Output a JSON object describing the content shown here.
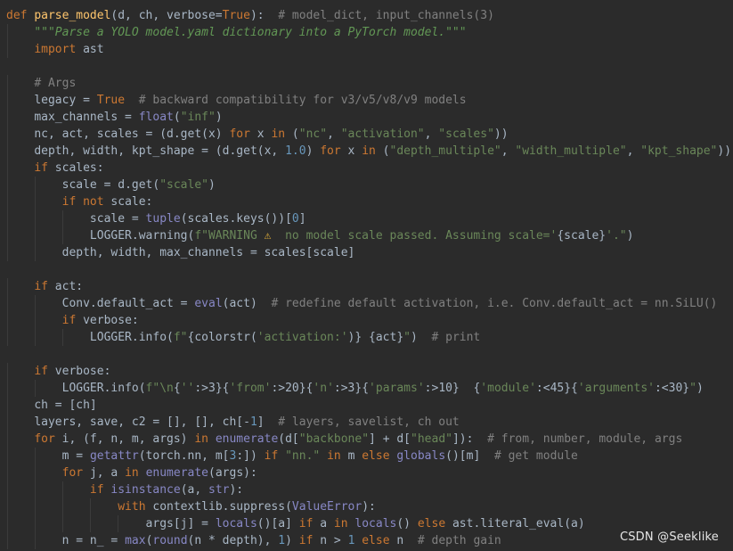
{
  "editor": {
    "theme": "dark",
    "colors": {
      "background": "#2b2b2b",
      "keyword": "#cc7832",
      "function": "#ffc66d",
      "builtin": "#8888c6",
      "string": "#6a8759",
      "docstring": "#629755",
      "comment": "#808080",
      "number": "#6897bb",
      "text": "#a9b7c6"
    },
    "lines": [
      {
        "indent": 0,
        "tokens": [
          [
            "kw",
            "def "
          ],
          [
            "fn",
            "parse_model"
          ],
          [
            "txt",
            "(d, ch, verbose="
          ],
          [
            "kw",
            "True"
          ],
          [
            "txt",
            "):  "
          ],
          [
            "cmt",
            "# model_dict, input_channels(3)"
          ]
        ]
      },
      {
        "indent": 1,
        "tokens": [
          [
            "doc",
            "\"\"\"Parse a YOLO model.yaml dictionary into a PyTorch model.\"\"\""
          ]
        ]
      },
      {
        "indent": 1,
        "tokens": [
          [
            "kw",
            "import "
          ],
          [
            "txt",
            "ast"
          ]
        ]
      },
      {
        "indent": 0,
        "tokens": []
      },
      {
        "indent": 1,
        "tokens": [
          [
            "cmt",
            "# Args"
          ]
        ]
      },
      {
        "indent": 1,
        "tokens": [
          [
            "txt",
            "legacy = "
          ],
          [
            "kw",
            "True  "
          ],
          [
            "cmt",
            "# backward compatibility for v3/v5/v8/v9 models"
          ]
        ]
      },
      {
        "indent": 1,
        "tokens": [
          [
            "txt",
            "max_channels = "
          ],
          [
            "bi",
            "float"
          ],
          [
            "txt",
            "("
          ],
          [
            "str",
            "\"inf\""
          ],
          [
            "txt",
            ")"
          ]
        ]
      },
      {
        "indent": 1,
        "tokens": [
          [
            "txt",
            "nc, act, scales = (d.get(x) "
          ],
          [
            "kw",
            "for "
          ],
          [
            "txt",
            "x "
          ],
          [
            "kw",
            "in "
          ],
          [
            "txt",
            "("
          ],
          [
            "str",
            "\"nc\""
          ],
          [
            "txt",
            ", "
          ],
          [
            "str",
            "\"activation\""
          ],
          [
            "txt",
            ", "
          ],
          [
            "str",
            "\"scales\""
          ],
          [
            "txt",
            "))"
          ]
        ]
      },
      {
        "indent": 1,
        "tokens": [
          [
            "txt",
            "depth, width, kpt_shape = (d.get(x, "
          ],
          [
            "num",
            "1.0"
          ],
          [
            "txt",
            ") "
          ],
          [
            "kw",
            "for "
          ],
          [
            "txt",
            "x "
          ],
          [
            "kw",
            "in "
          ],
          [
            "txt",
            "("
          ],
          [
            "str",
            "\"depth_multiple\""
          ],
          [
            "txt",
            ", "
          ],
          [
            "str",
            "\"width_multiple\""
          ],
          [
            "txt",
            ", "
          ],
          [
            "str",
            "\"kpt_shape\""
          ],
          [
            "txt",
            "))"
          ]
        ]
      },
      {
        "indent": 1,
        "tokens": [
          [
            "kw",
            "if "
          ],
          [
            "txt",
            "scales:"
          ]
        ]
      },
      {
        "indent": 2,
        "tokens": [
          [
            "txt",
            "scale = d.get("
          ],
          [
            "str",
            "\"scale\""
          ],
          [
            "txt",
            ")"
          ]
        ]
      },
      {
        "indent": 2,
        "tokens": [
          [
            "kw",
            "if not "
          ],
          [
            "txt",
            "scale:"
          ]
        ]
      },
      {
        "indent": 3,
        "tokens": [
          [
            "txt",
            "scale = "
          ],
          [
            "bi",
            "tuple"
          ],
          [
            "txt",
            "(scales.keys())["
          ],
          [
            "num",
            "0"
          ],
          [
            "txt",
            "]"
          ]
        ]
      },
      {
        "indent": 3,
        "tokens": [
          [
            "txt",
            "LOGGER.warning("
          ],
          [
            "str",
            "f\"WARNING "
          ],
          [
            "warn",
            "⚠"
          ],
          [
            "str",
            "  no model scale passed. Assuming scale='"
          ],
          [
            "txt",
            "{scale}"
          ],
          [
            "str",
            "'.\""
          ],
          [
            "txt",
            ")"
          ]
        ]
      },
      {
        "indent": 2,
        "tokens": [
          [
            "txt",
            "depth, width, max_channels = scales[scale]"
          ]
        ]
      },
      {
        "indent": 0,
        "tokens": []
      },
      {
        "indent": 1,
        "tokens": [
          [
            "kw",
            "if "
          ],
          [
            "txt",
            "act:"
          ]
        ]
      },
      {
        "indent": 2,
        "tokens": [
          [
            "txt",
            "Conv.default_act = "
          ],
          [
            "bi",
            "eval"
          ],
          [
            "txt",
            "(act)  "
          ],
          [
            "cmt",
            "# redefine default activation, i.e. Conv.default_act = nn.SiLU()"
          ]
        ]
      },
      {
        "indent": 2,
        "tokens": [
          [
            "kw",
            "if "
          ],
          [
            "txt",
            "verbose:"
          ]
        ]
      },
      {
        "indent": 3,
        "tokens": [
          [
            "txt",
            "LOGGER.info("
          ],
          [
            "str",
            "f\""
          ],
          [
            "txt",
            "{colorstr("
          ],
          [
            "str",
            "'activation:'"
          ],
          [
            "txt",
            ")}"
          ],
          [
            "str",
            " "
          ],
          [
            "txt",
            "{act}"
          ],
          [
            "str",
            "\""
          ],
          [
            "txt",
            ")  "
          ],
          [
            "cmt",
            "# print"
          ]
        ]
      },
      {
        "indent": 0,
        "tokens": []
      },
      {
        "indent": 1,
        "tokens": [
          [
            "kw",
            "if "
          ],
          [
            "txt",
            "verbose:"
          ]
        ]
      },
      {
        "indent": 2,
        "tokens": [
          [
            "txt",
            "LOGGER.info("
          ],
          [
            "str",
            "f\"\\n"
          ],
          [
            "txt",
            "{"
          ],
          [
            "str",
            "''"
          ],
          [
            "txt",
            ":>3}{"
          ],
          [
            "str",
            "'from'"
          ],
          [
            "txt",
            ":>20}{"
          ],
          [
            "str",
            "'n'"
          ],
          [
            "txt",
            ":>3}{"
          ],
          [
            "str",
            "'params'"
          ],
          [
            "txt",
            ":>10}"
          ],
          [
            "str",
            "  "
          ],
          [
            "txt",
            "{"
          ],
          [
            "str",
            "'module'"
          ],
          [
            "txt",
            ":<45}{"
          ],
          [
            "str",
            "'arguments'"
          ],
          [
            "txt",
            ":<30}"
          ],
          [
            "str",
            "\""
          ],
          [
            "txt",
            ")"
          ]
        ]
      },
      {
        "indent": 1,
        "tokens": [
          [
            "txt",
            "ch = [ch]"
          ]
        ]
      },
      {
        "indent": 1,
        "tokens": [
          [
            "txt",
            "layers, save, c2 = [], [], ch[-"
          ],
          [
            "num",
            "1"
          ],
          [
            "txt",
            "]  "
          ],
          [
            "cmt",
            "# layers, savelist, ch out"
          ]
        ]
      },
      {
        "indent": 1,
        "tokens": [
          [
            "kw",
            "for "
          ],
          [
            "txt",
            "i, (f, n, m, args) "
          ],
          [
            "kw",
            "in "
          ],
          [
            "bi",
            "enumerate"
          ],
          [
            "txt",
            "(d["
          ],
          [
            "str",
            "\"backbone\""
          ],
          [
            "txt",
            "] + d["
          ],
          [
            "str",
            "\"head\""
          ],
          [
            "txt",
            "]):  "
          ],
          [
            "cmt",
            "# from, number, module, args"
          ]
        ]
      },
      {
        "indent": 2,
        "tokens": [
          [
            "txt",
            "m = "
          ],
          [
            "bi",
            "getattr"
          ],
          [
            "txt",
            "(torch.nn, m["
          ],
          [
            "num",
            "3"
          ],
          [
            "txt",
            ":]) "
          ],
          [
            "kw",
            "if "
          ],
          [
            "str",
            "\"nn.\""
          ],
          [
            "kw",
            " in "
          ],
          [
            "txt",
            "m "
          ],
          [
            "kw",
            "else "
          ],
          [
            "bi",
            "globals"
          ],
          [
            "txt",
            "()[m]  "
          ],
          [
            "cmt",
            "# get module"
          ]
        ]
      },
      {
        "indent": 2,
        "tokens": [
          [
            "kw",
            "for "
          ],
          [
            "txt",
            "j, a "
          ],
          [
            "kw",
            "in "
          ],
          [
            "bi",
            "enumerate"
          ],
          [
            "txt",
            "(args):"
          ]
        ]
      },
      {
        "indent": 3,
        "tokens": [
          [
            "kw",
            "if "
          ],
          [
            "bi",
            "isinstance"
          ],
          [
            "txt",
            "(a, "
          ],
          [
            "bi",
            "str"
          ],
          [
            "txt",
            "):"
          ]
        ]
      },
      {
        "indent": 4,
        "tokens": [
          [
            "kw",
            "with "
          ],
          [
            "txt",
            "contextlib.suppress("
          ],
          [
            "bi",
            "ValueError"
          ],
          [
            "txt",
            "):"
          ]
        ]
      },
      {
        "indent": 5,
        "tokens": [
          [
            "txt",
            "args[j] = "
          ],
          [
            "bi",
            "locals"
          ],
          [
            "txt",
            "()[a] "
          ],
          [
            "kw",
            "if "
          ],
          [
            "txt",
            "a "
          ],
          [
            "kw",
            "in "
          ],
          [
            "bi",
            "locals"
          ],
          [
            "txt",
            "() "
          ],
          [
            "kw",
            "else "
          ],
          [
            "txt",
            "ast.literal_eval(a)"
          ]
        ]
      },
      {
        "indent": 2,
        "tokens": [
          [
            "txt",
            "n = n_ = "
          ],
          [
            "bi",
            "max"
          ],
          [
            "txt",
            "("
          ],
          [
            "bi",
            "round"
          ],
          [
            "txt",
            "(n * depth), "
          ],
          [
            "num",
            "1"
          ],
          [
            "txt",
            ") "
          ],
          [
            "kw",
            "if "
          ],
          [
            "txt",
            "n > "
          ],
          [
            "num",
            "1 "
          ],
          [
            "kw",
            "else "
          ],
          [
            "txt",
            "n  "
          ],
          [
            "cmt",
            "# depth gain"
          ]
        ]
      }
    ]
  },
  "watermark": {
    "text": "CSDN @Seeklike"
  }
}
